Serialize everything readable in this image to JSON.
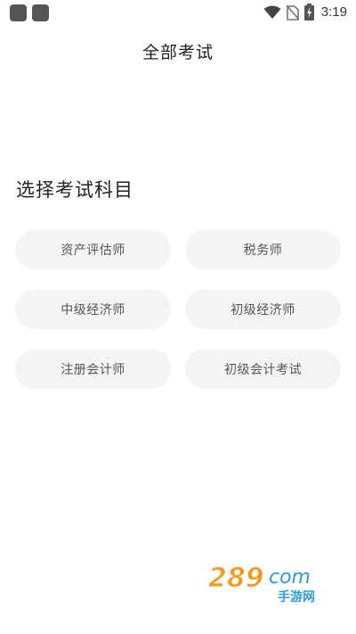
{
  "status_bar": {
    "time": "3:19",
    "icons": [
      "app-square-icon",
      "app-square-icon",
      "wifi-icon",
      "no-sim-icon",
      "battery-charging-icon"
    ]
  },
  "header": {
    "title": "全部考试"
  },
  "section": {
    "title": "选择考试科目"
  },
  "exams": [
    {
      "label": "资产评估师"
    },
    {
      "label": "税务师"
    },
    {
      "label": "中级经济师"
    },
    {
      "label": "初级经济师"
    },
    {
      "label": "注册会计师"
    },
    {
      "label": "初级会计考试"
    }
  ],
  "watermark": {
    "logo_text": "289com",
    "sub_text": "手游网",
    "colors": {
      "orange": "#f39a1e",
      "blue": "#2f9be0"
    }
  },
  "colors": {
    "chip_bg": "#f3f4f3",
    "chip_text": "#555555",
    "title_text": "#222222"
  }
}
